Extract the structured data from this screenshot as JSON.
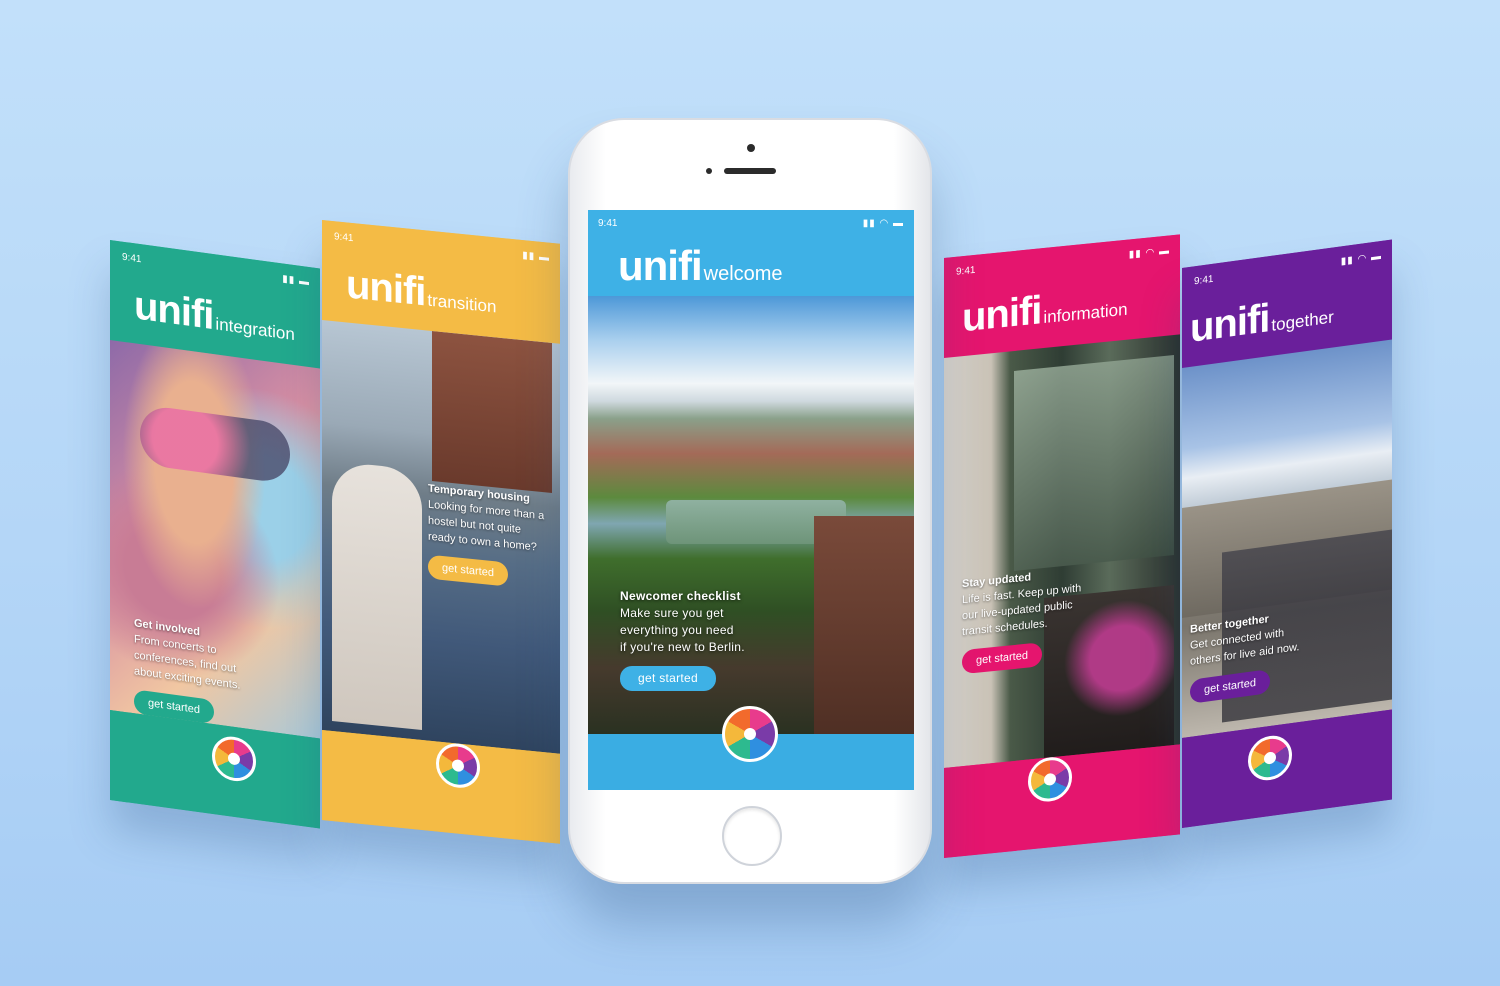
{
  "status": {
    "time": "9:41",
    "icons": [
      "signal-icon",
      "wifi-icon",
      "battery-icon"
    ]
  },
  "colors": {
    "background": "#b7d8f8",
    "integration": "#22a98d",
    "transition": "#f4bb45",
    "welcome": "#3eb1e6",
    "information": "#e5156e",
    "together": "#6a1f9b"
  },
  "brand": {
    "logo": "unifi"
  },
  "screens": {
    "integration": {
      "section": "integration",
      "heading": "Get involved",
      "lines": [
        "From concerts to",
        "conferences, find out",
        "about exciting events."
      ],
      "cta": "get started"
    },
    "transition": {
      "section": "transition",
      "heading": "Temporary housing",
      "lines": [
        "Looking for more than a",
        "hostel but not quite",
        "ready to own a home?"
      ],
      "cta": "get started"
    },
    "welcome": {
      "section": "welcome",
      "heading": "Newcomer checklist",
      "lines": [
        "Make sure you get",
        "everything you need",
        "if you're new to Berlin."
      ],
      "cta": "get started"
    },
    "information": {
      "section": "information",
      "heading": "Stay updated",
      "lines": [
        "Life is fast. Keep up with",
        "our live-updated public",
        "transit schedules."
      ],
      "cta": "get started"
    },
    "together": {
      "section": "together",
      "heading": "Better together",
      "lines": [
        "Get connected with",
        "others for live aid now."
      ],
      "cta": "get started"
    }
  }
}
